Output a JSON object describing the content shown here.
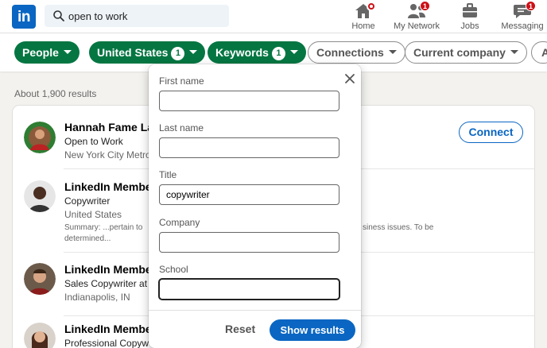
{
  "nav": {
    "logo_text": "in",
    "search_value": "open to work",
    "items": [
      {
        "label": "Home",
        "icon": "home-icon",
        "badge": ""
      },
      {
        "label": "My Network",
        "icon": "network-icon",
        "badge": "1"
      },
      {
        "label": "Jobs",
        "icon": "briefcase-icon",
        "badge": ""
      },
      {
        "label": "Messaging",
        "icon": "messaging-icon",
        "badge": "1"
      }
    ]
  },
  "filters": {
    "people": "People",
    "location": "United States",
    "location_count": "1",
    "keywords": "Keywords",
    "keywords_count": "1",
    "connections": "Connections",
    "current_company": "Current company",
    "all": "A"
  },
  "results": {
    "count_text": "About 1,900 results",
    "connect_label": "Connect",
    "items": [
      {
        "name": "Hannah Fame Las",
        "headline": "Open to Work",
        "location": "New York City Metro"
      },
      {
        "name": "LinkedIn Member",
        "headline": "Copywriter",
        "location": "United States",
        "summary_left": "Summary: ...pertain to",
        "summary_left2": "determined...",
        "summary_right": "siness issues. To be"
      },
      {
        "name": "LinkedIn Member",
        "headline": "Sales Copywriter at",
        "location": "Indianapolis, IN"
      },
      {
        "name": "LinkedIn Member",
        "headline": "Professional Copyw",
        "location": ""
      }
    ]
  },
  "keywords_dropdown": {
    "first_name_label": "First name",
    "first_name_value": "",
    "last_name_label": "Last name",
    "last_name_value": "",
    "title_label": "Title",
    "title_value": "copywriter",
    "company_label": "Company",
    "company_value": "",
    "school_label": "School",
    "school_value": "",
    "reset_label": "Reset",
    "show_results_label": "Show results"
  },
  "colors": {
    "brand_blue": "#0a66c2",
    "filter_green": "#057642",
    "badge_red": "#cc1016"
  }
}
